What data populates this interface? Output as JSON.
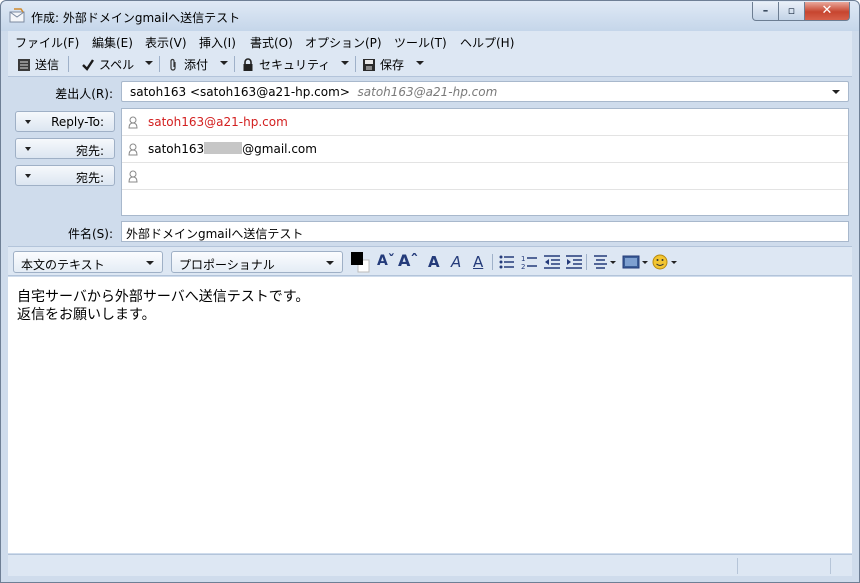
{
  "window": {
    "title": "作成: 外部ドメインgmailへ送信テスト",
    "controls": {
      "minimize": "–",
      "maximize": "▫",
      "close": "✕"
    }
  },
  "menu": [
    "ファイル(F)",
    "編集(E)",
    "表示(V)",
    "挿入(I)",
    "書式(O)",
    "オプション(P)",
    "ツール(T)",
    "ヘルプ(H)"
  ],
  "toolbar": {
    "send": "送信",
    "spell": "スペル",
    "attach": "添付",
    "security": "セキュリティ",
    "save": "保存"
  },
  "header": {
    "from_label": "差出人(R):",
    "from_value": "satoh163 <satoh163@a21-hp.com>",
    "from_hint": "satoh163@a21-hp.com",
    "rows": [
      {
        "type": "Reply-To:",
        "address": "satoh163@a21-hp.com",
        "address_color": "#d32020"
      },
      {
        "type": "宛先:",
        "address_prefix": "satoh163",
        "address_suffix": "@gmail.com"
      },
      {
        "type": "宛先:",
        "address": ""
      }
    ],
    "subject_label": "件名(S):",
    "subject_value": "外部ドメインgmailへ送信テスト"
  },
  "format": {
    "paragraph_style": "本文のテキスト",
    "font": "プロポーショナル"
  },
  "body": {
    "lines": [
      "自宅サーバから外部サーバへ送信テストです。",
      "返信をお願いします。"
    ]
  },
  "icons": {
    "send": "send-icon",
    "spell": "checkmark-icon",
    "attach": "paperclip-icon",
    "security": "lock-icon",
    "save": "floppy-disk-icon"
  }
}
